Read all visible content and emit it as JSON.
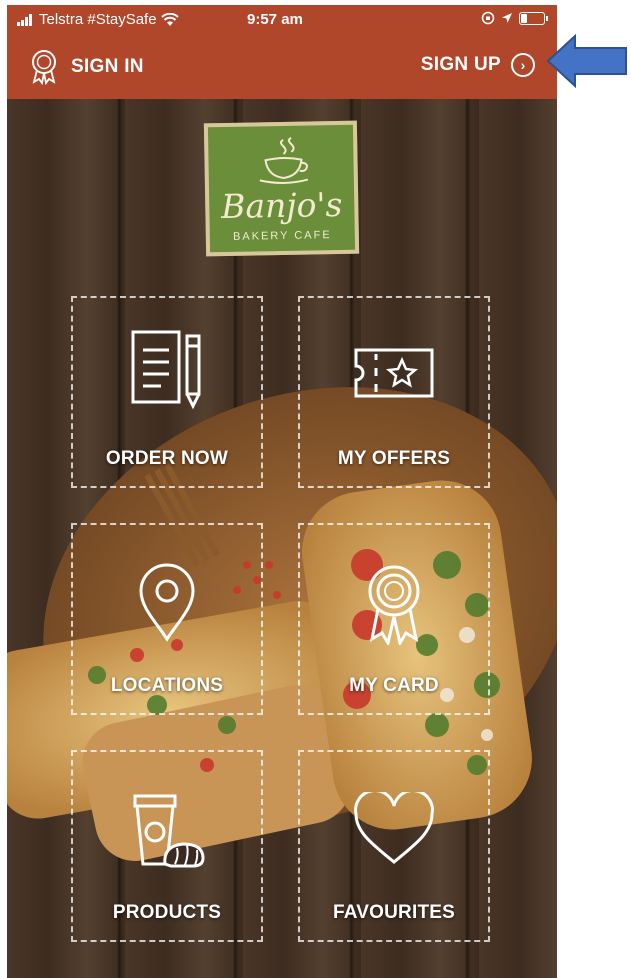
{
  "status_bar": {
    "carrier": "Telstra #StaySafe",
    "time": "9:57 am"
  },
  "nav": {
    "sign_in": "SIGN IN",
    "sign_up": "SIGN UP"
  },
  "logo": {
    "name": "Banjo's",
    "subtitle": "BAKERY CAFE"
  },
  "tiles": [
    {
      "label": "ORDER NOW",
      "icon": "order-notepad-icon"
    },
    {
      "label": "MY OFFERS",
      "icon": "ticket-star-icon"
    },
    {
      "label": "LOCATIONS",
      "icon": "location-pin-icon"
    },
    {
      "label": "MY CARD",
      "icon": "award-ribbon-icon"
    },
    {
      "label": "PRODUCTS",
      "icon": "coffee-pastry-icon"
    },
    {
      "label": "FAVOURITES",
      "icon": "heart-icon"
    }
  ],
  "colors": {
    "header": "#b0462a",
    "logo_green": "#6b8e3a",
    "arrow_blue": "#4472c4"
  }
}
